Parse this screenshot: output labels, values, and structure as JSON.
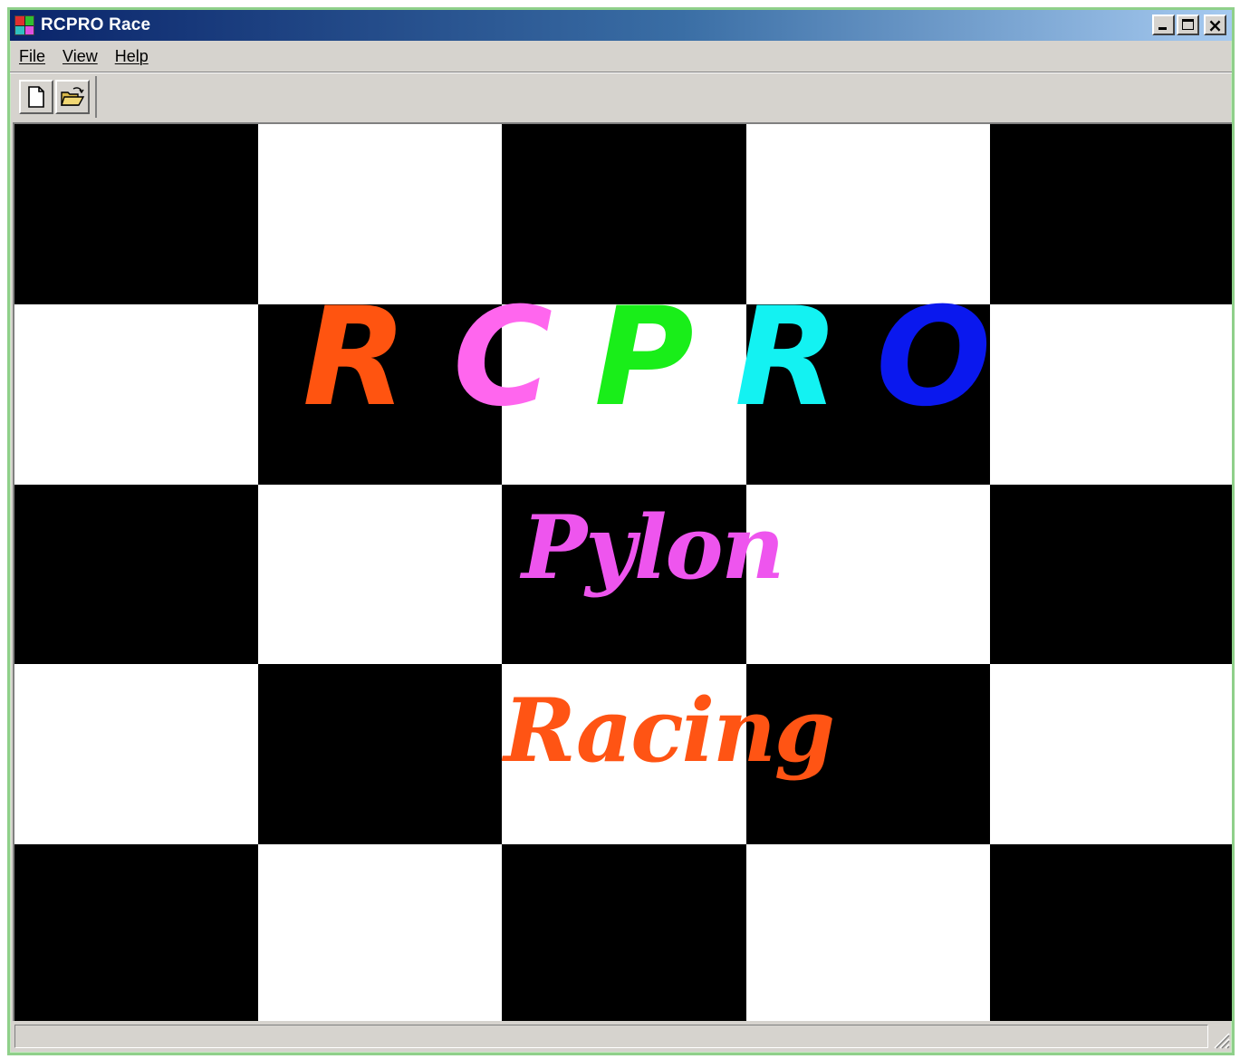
{
  "window": {
    "title": "RCPRO Race",
    "icon": "app-icon"
  },
  "title_controls": {
    "minimize_icon": "minimize-icon",
    "maximize_icon": "maximize-icon",
    "close_label": "×"
  },
  "menu": {
    "items": [
      "File",
      "View",
      "Help"
    ]
  },
  "toolbar": {
    "buttons": [
      {
        "icon": "new-document-icon"
      },
      {
        "icon": "open-folder-icon"
      }
    ]
  },
  "splash": {
    "letters": [
      {
        "char": "R",
        "color": "#ff5410"
      },
      {
        "char": "C",
        "color": "#ff66ee"
      },
      {
        "char": "P",
        "color": "#19ee19"
      },
      {
        "char": "R",
        "color": "#13f2f2"
      },
      {
        "char": "O",
        "color": "#0a18ee"
      }
    ],
    "line1": {
      "text": "Pylon",
      "color": "#ee55ee"
    },
    "line2": {
      "text": "Racing",
      "color": "#ff5414"
    },
    "board": {
      "rows": 5,
      "cols": 5,
      "dark": "#000000",
      "light": "#ffffff"
    }
  },
  "status": {
    "text": ""
  }
}
